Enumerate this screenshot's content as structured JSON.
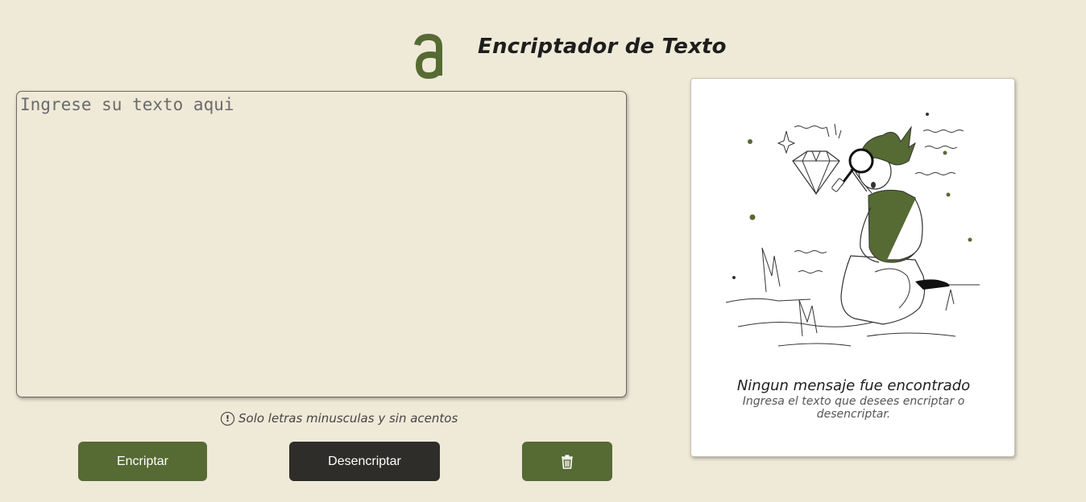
{
  "header": {
    "logo_icon": "alura-a-logo-icon",
    "title": "Encriptador de Texto"
  },
  "input": {
    "placeholder": "Ingrese su texto aqui",
    "value": ""
  },
  "hint": {
    "icon": "exclamation-circle-icon",
    "text": "Solo letras minusculas y sin acentos"
  },
  "buttons": {
    "encrypt_label": "Encriptar",
    "decrypt_label": "Desencriptar",
    "clear_icon": "trash-icon"
  },
  "output": {
    "illustration": "person-with-magnifying-glass-illustration",
    "title": "Ningun mensaje fue encontrado",
    "subtitle": "Ingresa el texto que desees encriptar o desencriptar."
  },
  "colors": {
    "background": "#efe9d8",
    "accent_green": "#566a33",
    "dark_button": "#2f2d2a",
    "card": "#ffffff"
  }
}
